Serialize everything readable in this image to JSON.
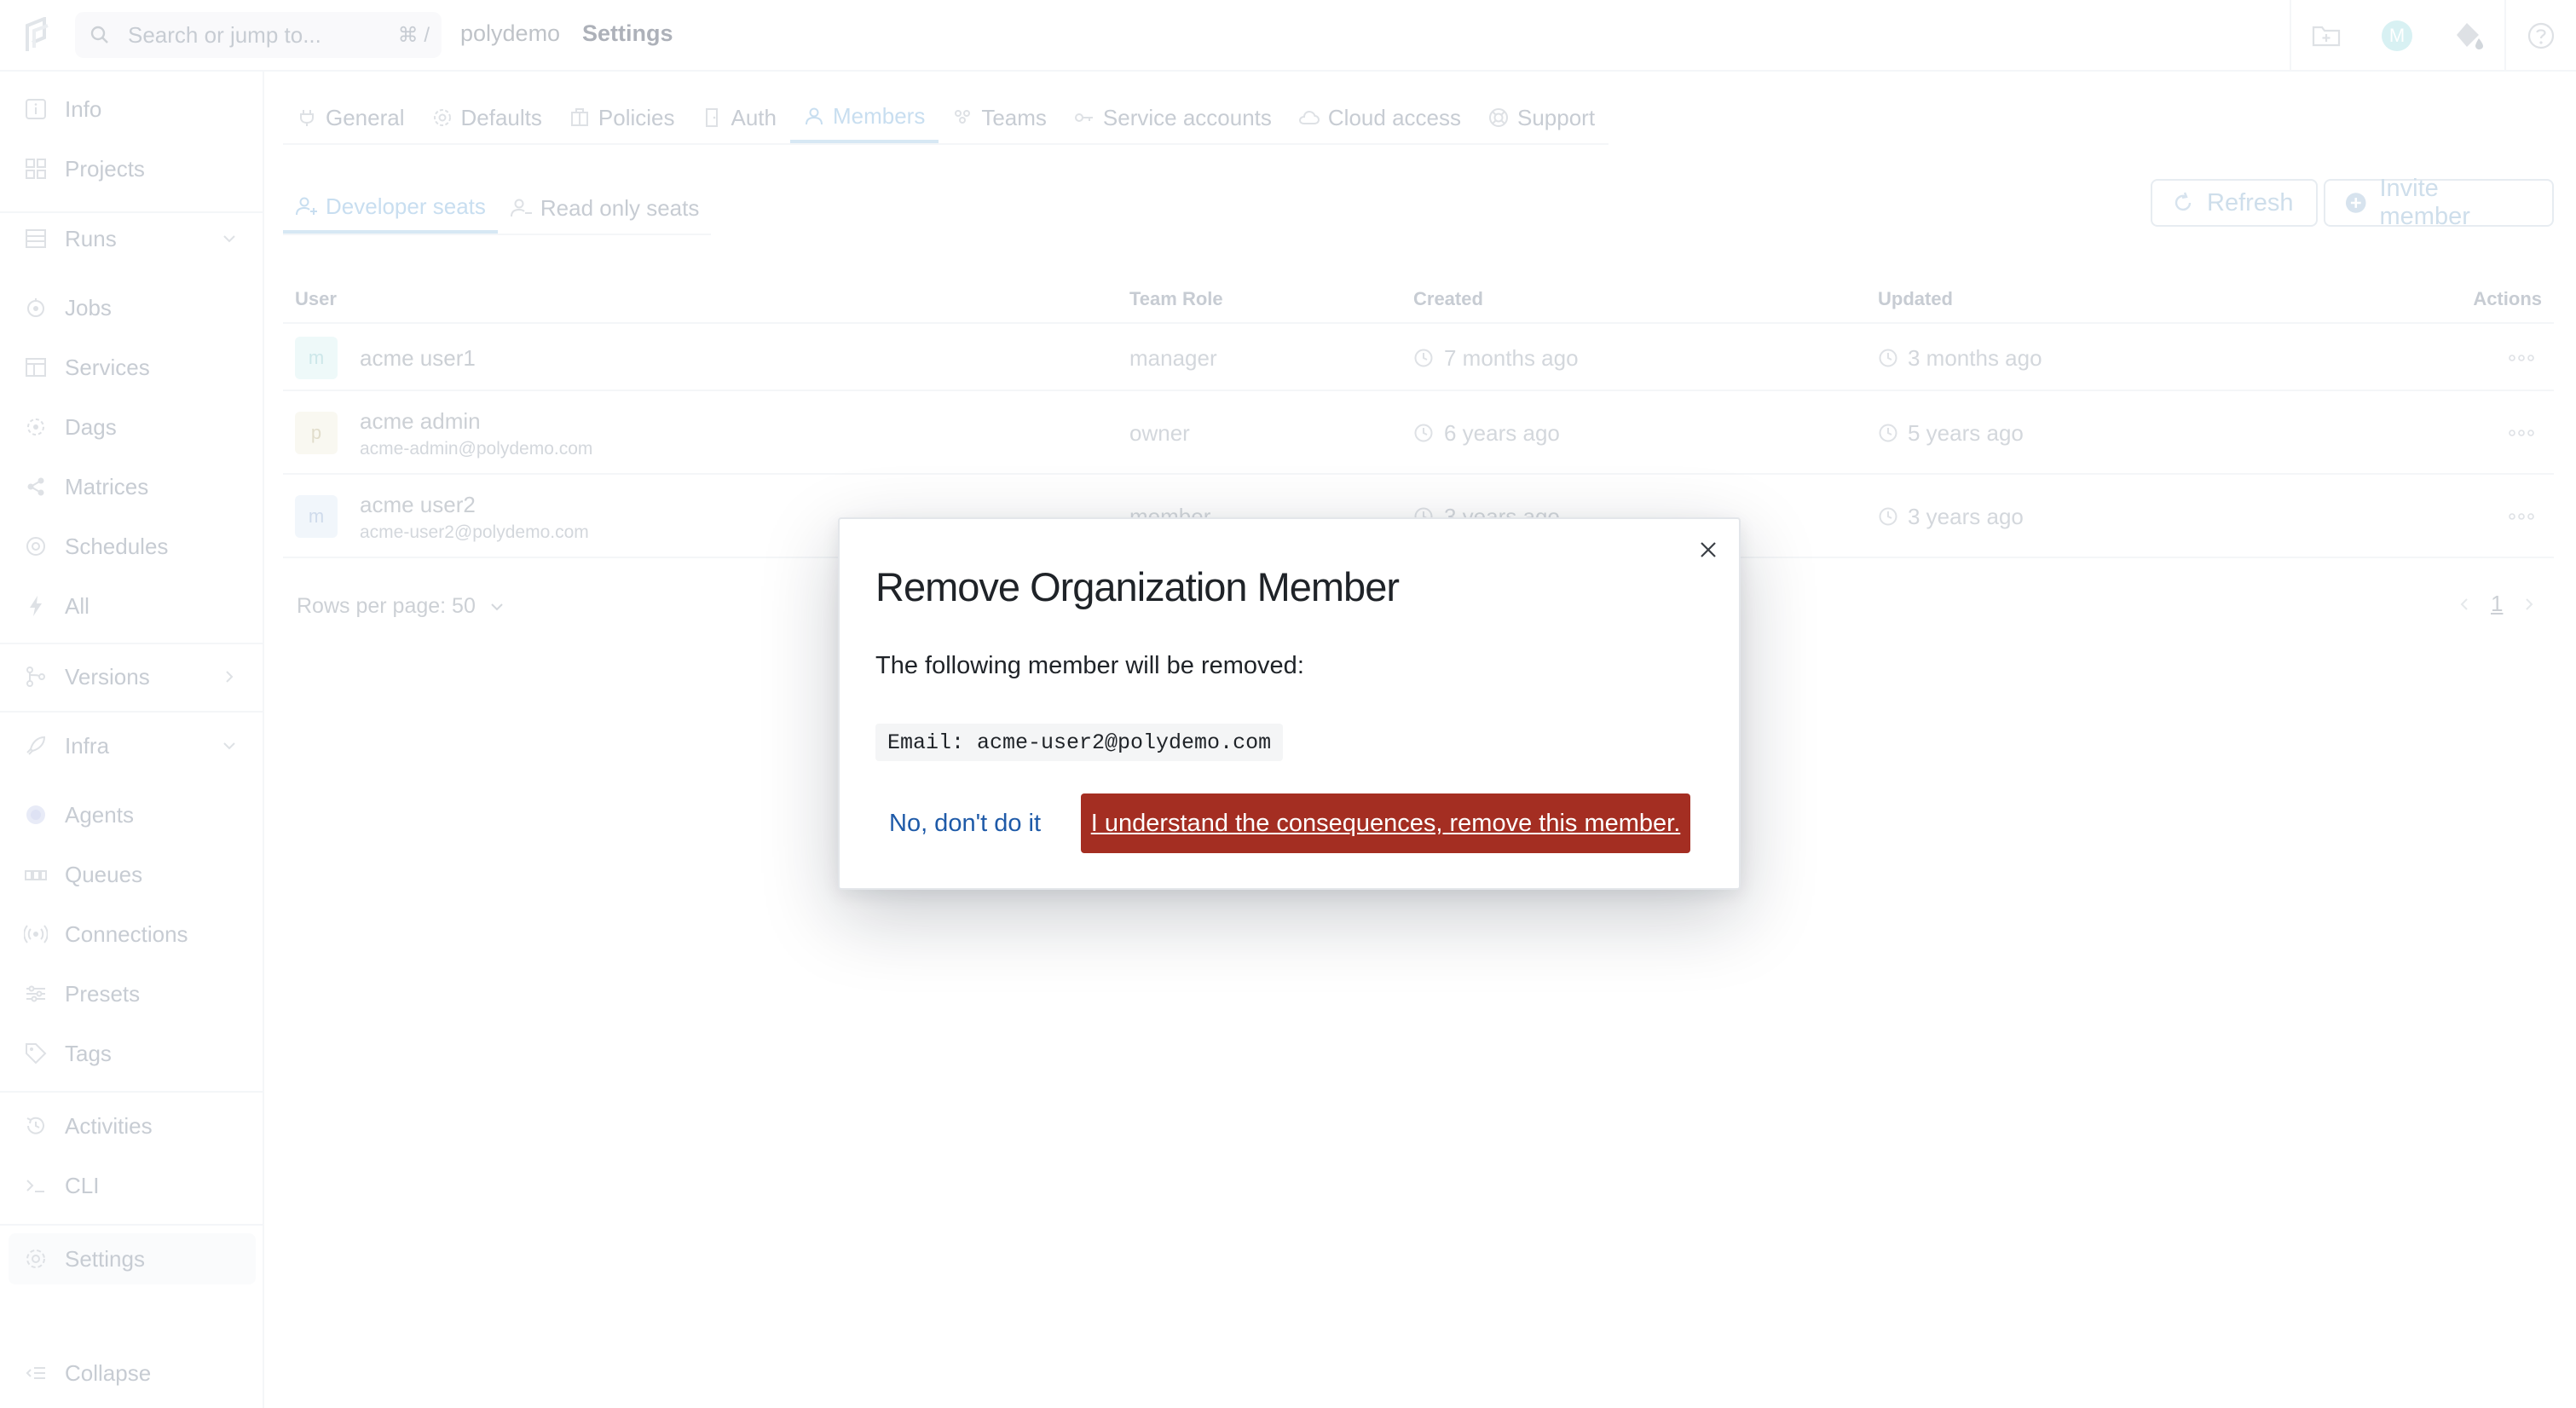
{
  "topbar": {
    "search_placeholder": "Search or jump to...",
    "search_shortcut": "⌘ /",
    "breadcrumb_org": "polydemo",
    "breadcrumb_page": "Settings",
    "avatar_letter": "M"
  },
  "sidebar": {
    "items": [
      {
        "label": "Info",
        "icon": "info-icon"
      },
      {
        "label": "Projects",
        "icon": "grid-icon"
      },
      {
        "label": "Runs",
        "icon": "list-icon"
      },
      {
        "label": "Jobs",
        "icon": "jobs-icon"
      },
      {
        "label": "Services",
        "icon": "services-icon"
      },
      {
        "label": "Dags",
        "icon": "dags-icon"
      },
      {
        "label": "Matrices",
        "icon": "matrices-icon"
      },
      {
        "label": "Schedules",
        "icon": "schedules-icon"
      },
      {
        "label": "All",
        "icon": "bolt-icon"
      },
      {
        "label": "Versions",
        "icon": "versions-icon"
      },
      {
        "label": "Infra",
        "icon": "rocket-icon"
      },
      {
        "label": "Agents",
        "icon": "agents-icon"
      },
      {
        "label": "Queues",
        "icon": "queues-icon"
      },
      {
        "label": "Connections",
        "icon": "connections-icon"
      },
      {
        "label": "Presets",
        "icon": "presets-icon"
      },
      {
        "label": "Tags",
        "icon": "tag-icon"
      },
      {
        "label": "Activities",
        "icon": "history-icon"
      },
      {
        "label": "CLI",
        "icon": "terminal-icon"
      },
      {
        "label": "Settings",
        "icon": "gear-icon"
      },
      {
        "label": "Collapse",
        "icon": "collapse-icon"
      }
    ]
  },
  "settings_tabs": [
    {
      "label": "General"
    },
    {
      "label": "Defaults"
    },
    {
      "label": "Policies"
    },
    {
      "label": "Auth"
    },
    {
      "label": "Members"
    },
    {
      "label": "Teams"
    },
    {
      "label": "Service accounts"
    },
    {
      "label": "Cloud access"
    },
    {
      "label": "Support"
    }
  ],
  "member_tabs": [
    {
      "label": "Developer seats"
    },
    {
      "label": "Read only seats"
    }
  ],
  "actions": {
    "refresh_label": "Refresh",
    "invite_label": "Invite member"
  },
  "table": {
    "headers": [
      "User",
      "Team Role",
      "Created",
      "Updated",
      "Actions"
    ],
    "rows": [
      {
        "initial": "m",
        "name": "acme user1",
        "email": "",
        "role": "manager",
        "created": "7 months ago",
        "updated": "3 months ago",
        "avatar_bg": "#e0f4f5",
        "avatar_fg": "#a3d3d8"
      },
      {
        "initial": "p",
        "name": "acme admin",
        "email": "acme-admin@polydemo.com",
        "role": "owner",
        "created": "6 years ago",
        "updated": "5 years ago",
        "avatar_bg": "#f4f2e6",
        "avatar_fg": "#c9c2a0"
      },
      {
        "initial": "m",
        "name": "acme user2",
        "email": "acme-user2@polydemo.com",
        "role": "member",
        "created": "3 years ago",
        "updated": "3 years ago",
        "avatar_bg": "#e6eef8",
        "avatar_fg": "#a8bddb"
      }
    ]
  },
  "pagination": {
    "rows_per_page": "Rows per page: 50",
    "page": "1"
  },
  "modal": {
    "title": "Remove Organization Member",
    "description": "The following member will be removed:",
    "code": "Email: acme-user2@polydemo.com",
    "cancel_label": "No, don't do it",
    "confirm_label": "I understand the consequences, remove this member.",
    "danger_color": "#a42e22"
  }
}
